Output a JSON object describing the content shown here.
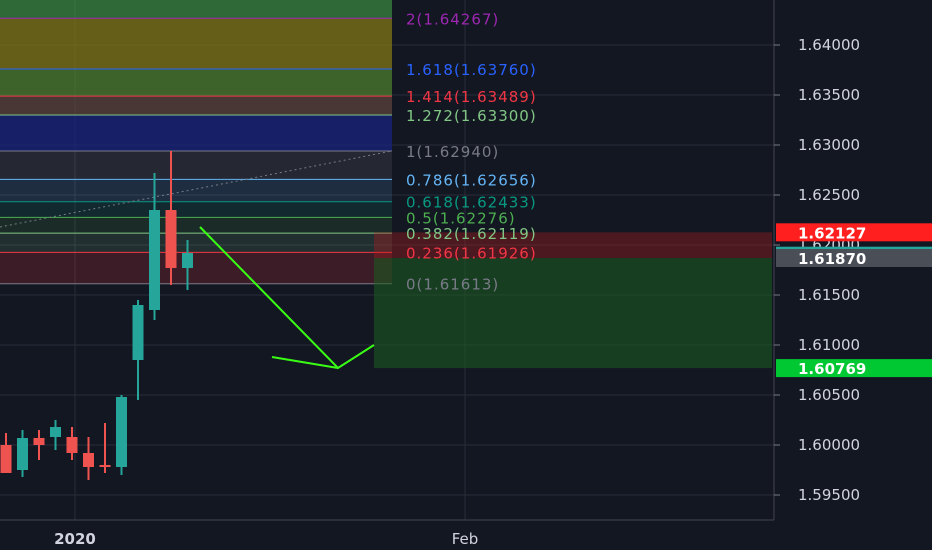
{
  "chart_data": {
    "type": "candlestick",
    "title": "",
    "xlabel": "",
    "ylabel": "",
    "ylim": [
      1.5925,
      1.6445
    ],
    "grid": true,
    "x_ticks": [
      "2020",
      "Feb"
    ],
    "y_ticks": [
      "1.64000",
      "1.63500",
      "1.63000",
      "1.62500",
      "1.62000",
      "1.61500",
      "1.61000",
      "1.60500",
      "1.60000",
      "1.59500"
    ],
    "y_tick_values": [
      1.64,
      1.635,
      1.63,
      1.625,
      1.62,
      1.615,
      1.61,
      1.605,
      1.6,
      1.595
    ],
    "price_labels": [
      {
        "text": "1.62127",
        "value": 1.62127,
        "color": "#ff1f1f"
      },
      {
        "text": "1.61893",
        "value": 1.61893,
        "color": "#26a69a"
      },
      {
        "text": "1.61870",
        "value": 1.6187,
        "color": "#4a4e57"
      },
      {
        "text": "1.60769",
        "value": 1.60769,
        "color": "#00c832"
      }
    ],
    "candles": [
      {
        "o": 1.6,
        "h": 1.6012,
        "l": 1.5972,
        "c": 1.5972
      },
      {
        "o": 1.5975,
        "h": 1.6015,
        "l": 1.5968,
        "c": 1.6007
      },
      {
        "o": 1.6007,
        "h": 1.6015,
        "l": 1.5985,
        "c": 1.6
      },
      {
        "o": 1.6008,
        "h": 1.6025,
        "l": 1.5995,
        "c": 1.6018
      },
      {
        "o": 1.6008,
        "h": 1.6018,
        "l": 1.5985,
        "c": 1.5992
      },
      {
        "o": 1.5992,
        "h": 1.6008,
        "l": 1.5965,
        "c": 1.5978
      },
      {
        "o": 1.598,
        "h": 1.6022,
        "l": 1.5972,
        "c": 1.5978
      },
      {
        "o": 1.5978,
        "h": 1.605,
        "l": 1.597,
        "c": 1.6048
      },
      {
        "o": 1.6085,
        "h": 1.6145,
        "l": 1.6045,
        "c": 1.614
      },
      {
        "o": 1.6135,
        "h": 1.6272,
        "l": 1.6125,
        "c": 1.6235
      },
      {
        "o": 1.6235,
        "h": 1.6294,
        "l": 1.616,
        "c": 1.6177
      },
      {
        "o": 1.6177,
        "h": 1.6205,
        "l": 1.6155,
        "c": 1.6192
      }
    ],
    "fib_levels": [
      {
        "ratio": "0",
        "value": 1.61613,
        "label": "0(1.61613)",
        "color": "#787b86"
      },
      {
        "ratio": "0.236",
        "value": 1.61926,
        "label": "0.236(1.61926)",
        "color": "#f23645"
      },
      {
        "ratio": "0.382",
        "value": 1.62119,
        "label": "0.382(1.62119)",
        "color": "#81c784"
      },
      {
        "ratio": "0.5",
        "value": 1.62276,
        "label": "0.5(1.62276)",
        "color": "#4caf50"
      },
      {
        "ratio": "0.618",
        "value": 1.62433,
        "label": "0.618(1.62433)",
        "color": "#089981"
      },
      {
        "ratio": "0.786",
        "value": 1.62656,
        "label": "0.786(1.62656)",
        "color": "#64b5f6"
      },
      {
        "ratio": "1",
        "value": 1.6294,
        "label": "1(1.62940)",
        "color": "#787b86"
      },
      {
        "ratio": "1.272",
        "value": 1.633,
        "label": "1.272(1.63300)",
        "color": "#81c784"
      },
      {
        "ratio": "1.414",
        "value": 1.63489,
        "label": "1.414(1.63489)",
        "color": "#f23645"
      },
      {
        "ratio": "1.618",
        "value": 1.6376,
        "label": "1.618(1.63760)",
        "color": "#2962ff"
      },
      {
        "ratio": "2",
        "value": 1.64267,
        "label": "2(1.64267)",
        "color": "#9c27b0"
      }
    ],
    "fib_bands": [
      {
        "from": 1.61613,
        "to": 1.61926,
        "color": "#f23645",
        "opacity": 0.18
      },
      {
        "from": 1.61926,
        "to": 1.62119,
        "color": "#81c784",
        "opacity": 0.14
      },
      {
        "from": 1.62119,
        "to": 1.62276,
        "color": "#4caf50",
        "opacity": 0.14
      },
      {
        "from": 1.62276,
        "to": 1.62433,
        "color": "#089981",
        "opacity": 0.14
      },
      {
        "from": 1.62433,
        "to": 1.62656,
        "color": "#64b5f6",
        "opacity": 0.14
      },
      {
        "from": 1.62656,
        "to": 1.6294,
        "color": "#787b86",
        "opacity": 0.18
      },
      {
        "from": 1.6294,
        "to": 1.633,
        "color": "#1a237e",
        "opacity": 0.75
      },
      {
        "from": 1.633,
        "to": 1.63489,
        "color": "#6d4c41",
        "opacity": 0.6
      },
      {
        "from": 1.63489,
        "to": 1.6376,
        "color": "#558b2f",
        "opacity": 0.65
      },
      {
        "from": 1.6376,
        "to": 1.64267,
        "color": "#827717",
        "opacity": 0.75
      },
      {
        "from": 1.64267,
        "to": 1.6445,
        "color": "#43a047",
        "opacity": 0.6
      }
    ],
    "position": {
      "entry": 1.6187,
      "stop": 1.62127,
      "target": 1.60769
    },
    "colors": {
      "up": "#26a69a",
      "down": "#ef5350",
      "arrow": "#39ff14",
      "background": "#131722",
      "grid": "#2a2e39",
      "axis_text": "#d1d4dc"
    }
  }
}
